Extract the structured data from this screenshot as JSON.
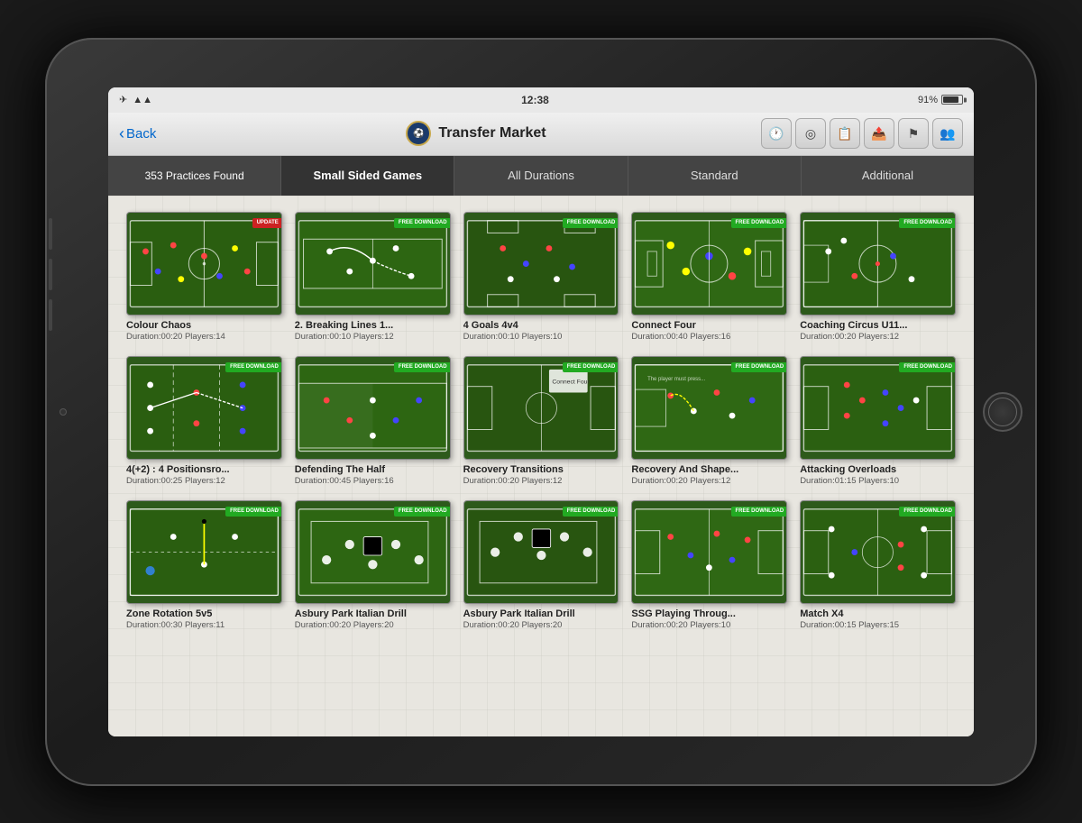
{
  "device": {
    "status_bar": {
      "time": "12:38",
      "battery": "91%",
      "wifi": "wifi",
      "airplane": "✈"
    },
    "nav": {
      "back_label": "Back",
      "logo_text": "FA",
      "title": "Transfer Market"
    },
    "nav_icons": [
      "🕐",
      "⊕",
      "📋",
      "📤",
      "🔱",
      "👥"
    ]
  },
  "filter_bar": {
    "items": [
      {
        "label": "353 Practices Found",
        "active": false
      },
      {
        "label": "Small Sided Games",
        "active": true
      },
      {
        "label": "All Durations",
        "active": false
      },
      {
        "label": "Standard",
        "active": false
      },
      {
        "label": "Additional",
        "active": false
      }
    ]
  },
  "practices": [
    {
      "title": "Colour Chaos",
      "duration": "00:20",
      "players": "14",
      "badge": "UPDATE",
      "badge_type": "update",
      "color": "r1"
    },
    {
      "title": "2. Breaking Lines 1...",
      "duration": "00:10",
      "players": "12",
      "badge": "FREE DOWNLOAD",
      "badge_type": "free",
      "color": "r2"
    },
    {
      "title": "4 Goals 4v4",
      "duration": "00:10",
      "players": "10",
      "badge": "FREE DOWNLOAD",
      "badge_type": "free",
      "color": "r3"
    },
    {
      "title": "Connect Four",
      "duration": "00:40",
      "players": "16",
      "badge": "FREE DOWNLOAD",
      "badge_type": "free",
      "color": "r4"
    },
    {
      "title": "Coaching Circus U11...",
      "duration": "00:20",
      "players": "12",
      "badge": "FREE DOWNLOAD",
      "badge_type": "free",
      "color": "r5"
    },
    {
      "title": "4(+2) : 4 Positionsro...",
      "duration": "00:25",
      "players": "12",
      "badge": "FREE DOWNLOAD",
      "badge_type": "free",
      "color": "r6"
    },
    {
      "title": "Defending The Half",
      "duration": "00:45",
      "players": "16",
      "badge": "FREE DOWNLOAD",
      "badge_type": "free",
      "color": "r7"
    },
    {
      "title": "Recovery Transitions",
      "duration": "00:20",
      "players": "12",
      "badge": "FREE DOWNLOAD",
      "badge_type": "free",
      "color": "r8"
    },
    {
      "title": "Recovery And Shape...",
      "duration": "00:20",
      "players": "12",
      "badge": "FREE DOWNLOAD",
      "badge_type": "free",
      "color": "r9"
    },
    {
      "title": "Attacking Overloads",
      "duration": "01:15",
      "players": "10",
      "badge": "FREE DOWNLOAD",
      "badge_type": "free",
      "color": "r10"
    },
    {
      "title": "Zone Rotation 5v5",
      "duration": "00:30",
      "players": "11",
      "badge": "FREE DOWNLOAD",
      "badge_type": "free",
      "color": "r11"
    },
    {
      "title": "Asbury Park Italian Drill",
      "duration": "00:20",
      "players": "20",
      "badge": "FREE DOWNLOAD",
      "badge_type": "free",
      "color": "r12"
    },
    {
      "title": "Asbury Park Italian Drill",
      "duration": "00:20",
      "players": "20",
      "badge": "FREE DOWNLOAD",
      "badge_type": "free",
      "color": "r13"
    },
    {
      "title": "SSG Playing Throug...",
      "duration": "00:20",
      "players": "10",
      "badge": "FREE DOWNLOAD",
      "badge_type": "free",
      "color": "r14"
    },
    {
      "title": "Match X4",
      "duration": "00:15",
      "players": "15",
      "badge": "FREE DOWNLOAD",
      "badge_type": "free",
      "color": "r15"
    }
  ]
}
